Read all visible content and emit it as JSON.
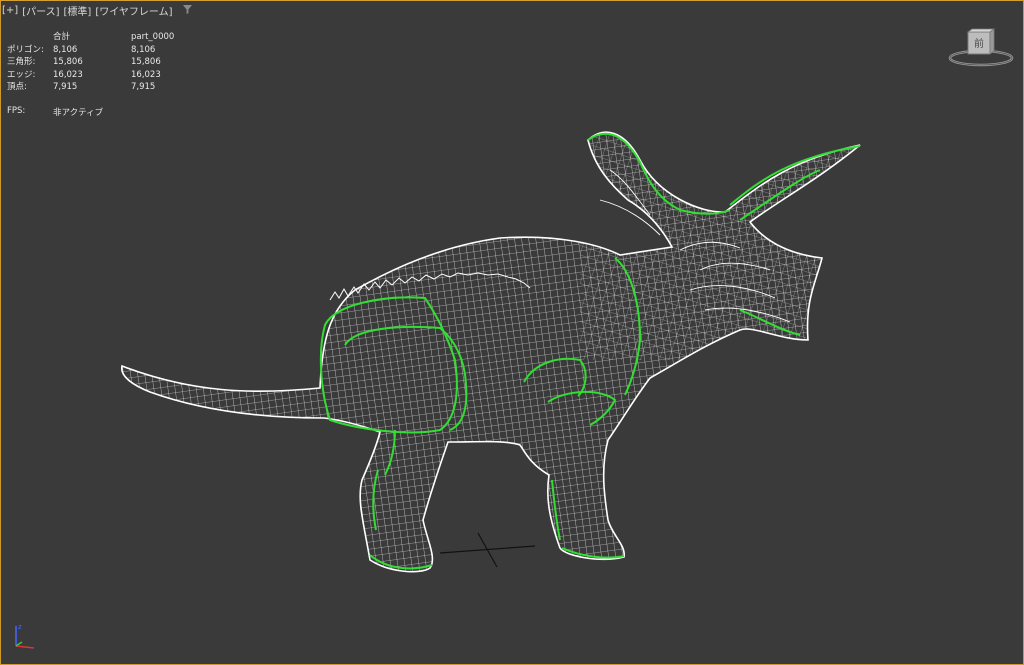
{
  "viewport": {
    "labels": [
      "[+]",
      "[パース]",
      "[標準]",
      "[ワイヤフレーム]"
    ],
    "filter_icon": "filter-icon"
  },
  "stats": {
    "headers": [
      "",
      "合計",
      "part_0000"
    ],
    "rows": [
      {
        "label": "ポリゴン:",
        "total": "8,106",
        "part": "8,106"
      },
      {
        "label": "三角形:",
        "total": "15,806",
        "part": "15,806"
      },
      {
        "label": "エッジ:",
        "total": "16,023",
        "part": "16,023"
      },
      {
        "label": "頂点:",
        "total": "7,915",
        "part": "7,915"
      }
    ],
    "fps_label": "FPS:",
    "fps_value": "非アクティブ"
  },
  "viewcube": {
    "face_label": "前"
  },
  "model": {
    "name": "part_0000",
    "wire_color": "#ffffff",
    "highlight_color": "#33dd33"
  },
  "colors": {
    "background": "#3a3a3a",
    "frame": "#cf9a2a"
  }
}
